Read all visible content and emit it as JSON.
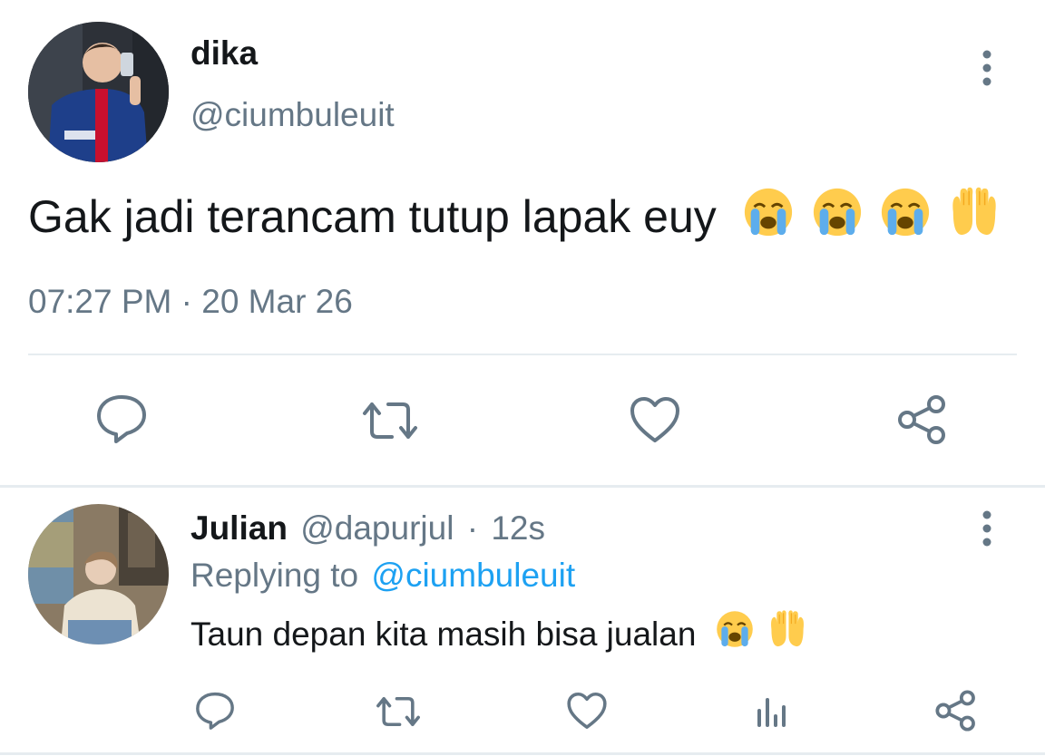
{
  "main_tweet": {
    "author_name": "dika",
    "handle": "@ciumbuleuit",
    "text": "Gak jadi terancam tutup lapak euy",
    "emojis": [
      "crying-face",
      "crying-face",
      "crying-face",
      "raised-hands"
    ],
    "timestamp": "07:27 PM · 20 Mar 26",
    "actions": [
      "reply-icon",
      "retweet-icon",
      "like-icon",
      "share-icon"
    ]
  },
  "reply": {
    "author_name": "Julian",
    "handle": "@dapurjul",
    "separator": "·",
    "time": "12s",
    "replying_to_label": "Replying to",
    "replying_to_handle": "@ciumbuleuit",
    "text": "Taun depan kita masih bisa jualan",
    "emojis": [
      "crying-face",
      "raised-hands"
    ],
    "actions": [
      "reply-icon",
      "retweet-icon",
      "like-icon",
      "analytics-icon",
      "share-icon"
    ]
  },
  "colors": {
    "text": "#14171a",
    "muted": "#657786",
    "link": "#1da1f2",
    "divider": "#e6ecf0",
    "icon": "#657786"
  }
}
